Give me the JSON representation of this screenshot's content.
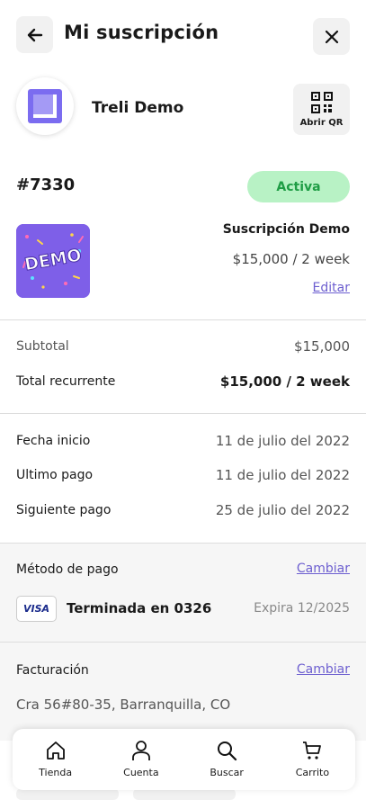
{
  "header": {
    "title": "Mi suscripción"
  },
  "store": {
    "name": "Treli Demo",
    "qr_label": "Abrir QR"
  },
  "order": {
    "id": "#7330",
    "status": "Activa"
  },
  "product": {
    "image_text": "DEMO",
    "name": "Suscripción Demo",
    "price": "$15,000 / 2 week",
    "edit_label": "Editar"
  },
  "totals": {
    "subtotal_label": "Subtotal",
    "subtotal_value": "$15,000",
    "recurring_label": "Total recurrente",
    "recurring_value": "$15,000 / 2 week"
  },
  "dates": {
    "start_label": "Fecha inicio",
    "start_value": "11 de julio del 2022",
    "last_label": "Ultimo pago",
    "last_value": "11 de julio del 2022",
    "next_label": "Siguiente pago",
    "next_value": "25 de julio del 2022"
  },
  "payment": {
    "title": "Método de pago",
    "change_label": "Cambiar",
    "card_brand": "VISA",
    "card_text": "Terminada en 0326",
    "expiry": "Expira 12/2025"
  },
  "billing": {
    "title": "Facturación",
    "change_label": "Cambiar",
    "address": "Cra 56#80-35, Barranquilla, CO"
  },
  "tabbar": {
    "items": [
      {
        "label": "Tienda",
        "icon": "home-icon"
      },
      {
        "label": "Cuenta",
        "icon": "user-icon"
      },
      {
        "label": "Buscar",
        "icon": "search-icon"
      },
      {
        "label": "Carrito",
        "icon": "cart-icon"
      }
    ]
  },
  "colors": {
    "accent": "#6d5fd0",
    "status_bg": "#b8f2c5",
    "status_text": "#1f9d45",
    "logo": "#7b6cf0",
    "product_bg": "#7e5fe8"
  }
}
